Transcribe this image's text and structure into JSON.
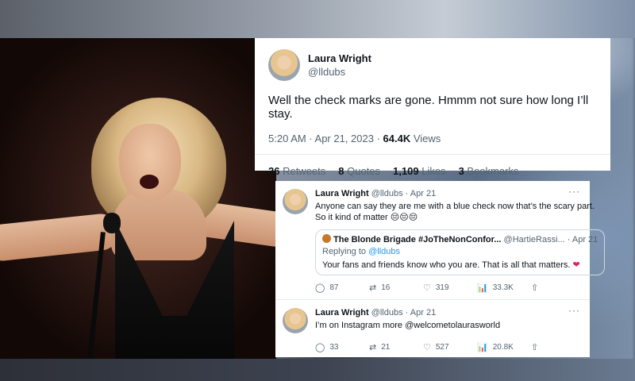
{
  "main_tweet": {
    "name": "Laura Wright",
    "handle": "@lldubs",
    "text": "Well the check marks are gone.  Hmmm not sure how long I’ll stay.",
    "time": "5:20 AM · Apr 21, 2023 · ",
    "views_count": "64.4K",
    "views_label": " Views",
    "retweets_count": "26",
    "retweets_label": " Retweets",
    "quotes_count": "8",
    "quotes_label": " Quotes",
    "likes_count": "1,109",
    "likes_label": " Likes",
    "bookmarks_count": "3",
    "bookmarks_label": " Bookmarks"
  },
  "replies": [
    {
      "name": "Laura Wright",
      "meta": " @lldubs · Apr 21",
      "text": "Anyone can say they are  me with a blue check now that’s the scary part. So it kind of matter 😔😔😔",
      "quote": {
        "name": "The Blonde Brigade #JoTheNonConfor...",
        "meta": " @HartieRassi... · Apr 21",
        "replying_label": "Replying to ",
        "replying_handle": "@lldubs",
        "text": "Your fans and friends know who you are. That is all that matters. "
      },
      "replies_count": "87",
      "retweets_count": "16",
      "likes_count": "319",
      "views_count": "33.3K"
    },
    {
      "name": "Laura Wright",
      "meta": " @lldubs · Apr 21",
      "text": "I’m on Instagram more @welcometolaurasworld",
      "replies_count": "33",
      "retweets_count": "21",
      "likes_count": "527",
      "views_count": "20.8K"
    }
  ],
  "icons": {
    "more": "···",
    "reply": "◯",
    "retweet": "⇄",
    "like": "♡",
    "views": "📊",
    "share": "⇧",
    "heart": "❤"
  }
}
